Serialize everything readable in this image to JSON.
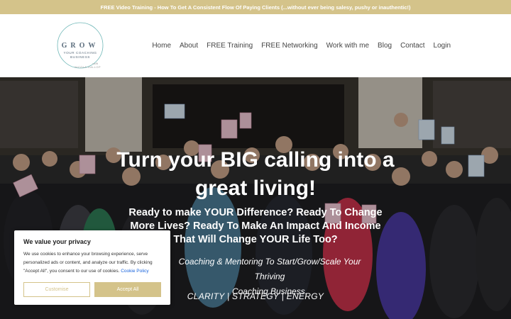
{
  "announcement": "FREE Video Training - How To Get A Consistent Flow Of Paying Clients (...without ever being salesy, pushy or inauthentic!)",
  "logo": {
    "word": "GROW",
    "line1": "YOUR COACHING",
    "line2": "BUSINESS",
    "line3": "with",
    "line4": "NICOLA GALLOP"
  },
  "nav": {
    "items": [
      "Home",
      "About",
      "FREE Training",
      "FREE Networking",
      "Work with me",
      "Blog",
      "Contact",
      "Login"
    ]
  },
  "hero": {
    "headline_line1": "Turn your BIG calling into a",
    "headline_line2": "great living!",
    "sub_line1": "Ready to make YOUR Difference? Ready To Change",
    "sub_line2": "More Lives?  Ready To Make An Impact And Income",
    "sub_line3": "That Will Change YOUR Life Too?",
    "tag_line1": "Coaching & Mentoring To Start/Grow/Scale Your Thriving",
    "tag_line2": "Coaching Business.",
    "pillars": "CLARITY | STRATEGY | ENERGY"
  },
  "cookie": {
    "title": "We value your privacy",
    "body": "We use cookies to enhance your browsing experience, serve personalized ads or content, and analyze our traffic. By clicking \"Accept All\", you consent to our use of cookies.",
    "policy_link": "Cookie Policy",
    "customise": "Customise",
    "accept": "Accept All"
  },
  "colors": {
    "brand_gold": "#d4c38a",
    "nav_text": "#444444",
    "link_blue": "#1863dc"
  }
}
